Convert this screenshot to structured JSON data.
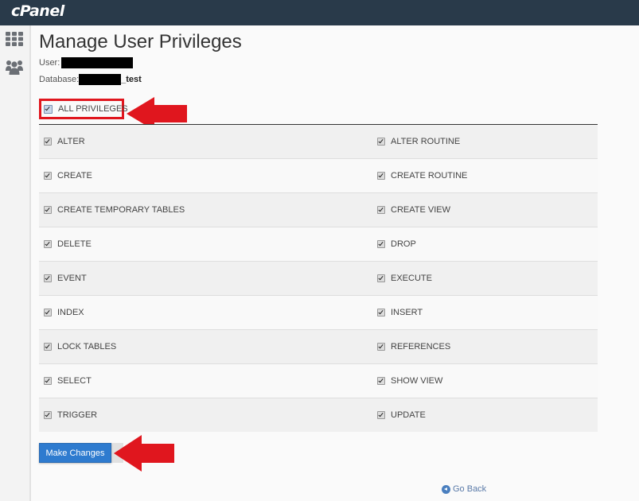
{
  "header": {
    "logo": "cPanel"
  },
  "sidebar": {
    "items": [
      {
        "icon": "grid-icon",
        "label": "Home"
      },
      {
        "icon": "users-icon",
        "label": "User Manager"
      }
    ]
  },
  "page": {
    "title": "Manage User Privileges",
    "user_label": "User:",
    "user_value": "[redacted]",
    "database_label": "Database:",
    "database_value_visible_suffix": "_test"
  },
  "all_privileges": {
    "label": "ALL PRIVILEGES",
    "checked": true
  },
  "privileges": {
    "rows": [
      {
        "left": {
          "label": "ALTER",
          "checked": true
        },
        "right": {
          "label": "ALTER ROUTINE",
          "checked": true
        }
      },
      {
        "left": {
          "label": "CREATE",
          "checked": true
        },
        "right": {
          "label": "CREATE ROUTINE",
          "checked": true
        }
      },
      {
        "left": {
          "label": "CREATE TEMPORARY TABLES",
          "checked": true
        },
        "right": {
          "label": "CREATE VIEW",
          "checked": true
        }
      },
      {
        "left": {
          "label": "DELETE",
          "checked": true
        },
        "right": {
          "label": "DROP",
          "checked": true
        }
      },
      {
        "left": {
          "label": "EVENT",
          "checked": true
        },
        "right": {
          "label": "EXECUTE",
          "checked": true
        }
      },
      {
        "left": {
          "label": "INDEX",
          "checked": true
        },
        "right": {
          "label": "INSERT",
          "checked": true
        }
      },
      {
        "left": {
          "label": "LOCK TABLES",
          "checked": true
        },
        "right": {
          "label": "REFERENCES",
          "checked": true
        }
      },
      {
        "left": {
          "label": "SELECT",
          "checked": true
        },
        "right": {
          "label": "SHOW VIEW",
          "checked": true
        }
      },
      {
        "left": {
          "label": "TRIGGER",
          "checked": true
        },
        "right": {
          "label": "UPDATE",
          "checked": true
        }
      }
    ]
  },
  "actions": {
    "make_changes": "Make Changes",
    "go_back": "Go Back"
  },
  "annotations": {
    "arrow_color": "#e0161e",
    "highlight_color": "#e0161e"
  }
}
